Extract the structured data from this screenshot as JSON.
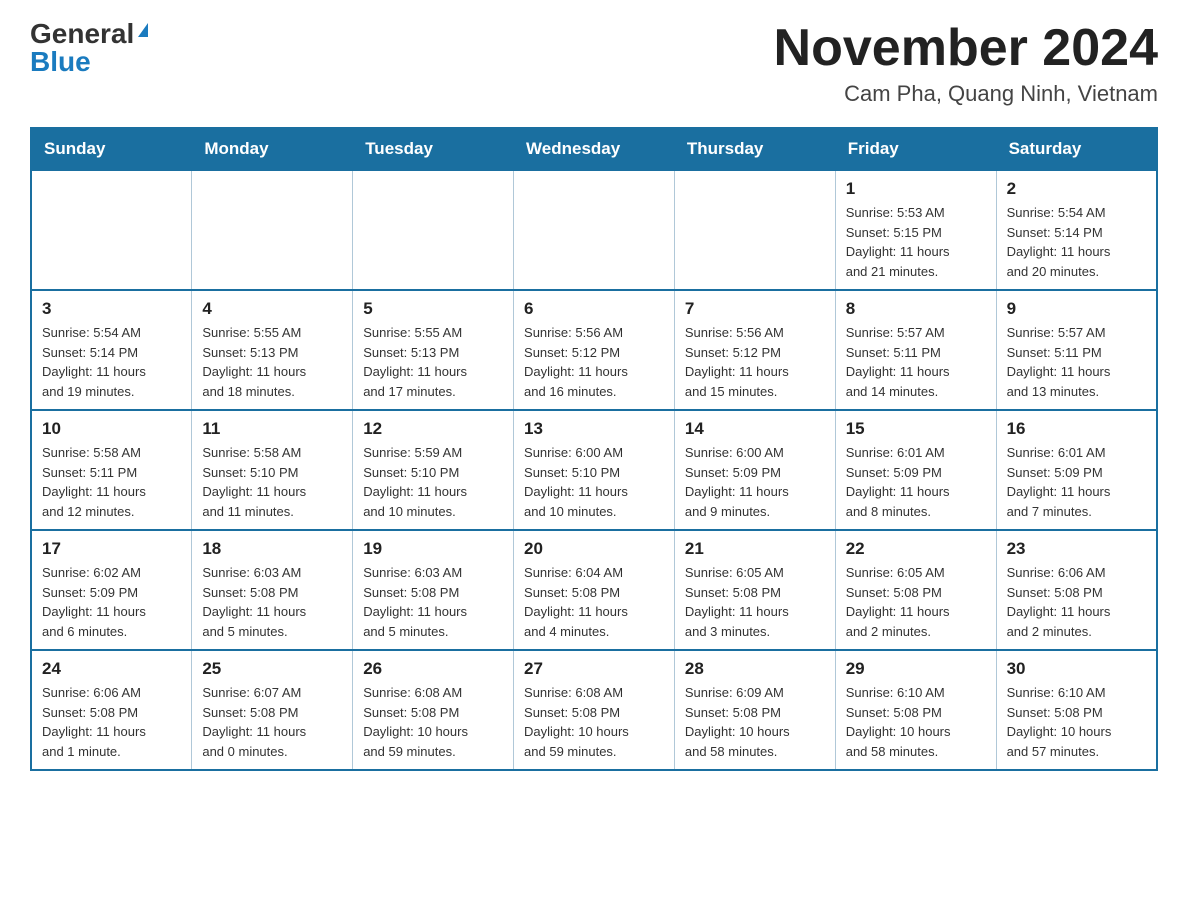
{
  "logo": {
    "general": "General",
    "blue": "Blue"
  },
  "title": "November 2024",
  "location": "Cam Pha, Quang Ninh, Vietnam",
  "days_of_week": [
    "Sunday",
    "Monday",
    "Tuesday",
    "Wednesday",
    "Thursday",
    "Friday",
    "Saturday"
  ],
  "weeks": [
    [
      {
        "day": "",
        "info": ""
      },
      {
        "day": "",
        "info": ""
      },
      {
        "day": "",
        "info": ""
      },
      {
        "day": "",
        "info": ""
      },
      {
        "day": "",
        "info": ""
      },
      {
        "day": "1",
        "info": "Sunrise: 5:53 AM\nSunset: 5:15 PM\nDaylight: 11 hours\nand 21 minutes."
      },
      {
        "day": "2",
        "info": "Sunrise: 5:54 AM\nSunset: 5:14 PM\nDaylight: 11 hours\nand 20 minutes."
      }
    ],
    [
      {
        "day": "3",
        "info": "Sunrise: 5:54 AM\nSunset: 5:14 PM\nDaylight: 11 hours\nand 19 minutes."
      },
      {
        "day": "4",
        "info": "Sunrise: 5:55 AM\nSunset: 5:13 PM\nDaylight: 11 hours\nand 18 minutes."
      },
      {
        "day": "5",
        "info": "Sunrise: 5:55 AM\nSunset: 5:13 PM\nDaylight: 11 hours\nand 17 minutes."
      },
      {
        "day": "6",
        "info": "Sunrise: 5:56 AM\nSunset: 5:12 PM\nDaylight: 11 hours\nand 16 minutes."
      },
      {
        "day": "7",
        "info": "Sunrise: 5:56 AM\nSunset: 5:12 PM\nDaylight: 11 hours\nand 15 minutes."
      },
      {
        "day": "8",
        "info": "Sunrise: 5:57 AM\nSunset: 5:11 PM\nDaylight: 11 hours\nand 14 minutes."
      },
      {
        "day": "9",
        "info": "Sunrise: 5:57 AM\nSunset: 5:11 PM\nDaylight: 11 hours\nand 13 minutes."
      }
    ],
    [
      {
        "day": "10",
        "info": "Sunrise: 5:58 AM\nSunset: 5:11 PM\nDaylight: 11 hours\nand 12 minutes."
      },
      {
        "day": "11",
        "info": "Sunrise: 5:58 AM\nSunset: 5:10 PM\nDaylight: 11 hours\nand 11 minutes."
      },
      {
        "day": "12",
        "info": "Sunrise: 5:59 AM\nSunset: 5:10 PM\nDaylight: 11 hours\nand 10 minutes."
      },
      {
        "day": "13",
        "info": "Sunrise: 6:00 AM\nSunset: 5:10 PM\nDaylight: 11 hours\nand 10 minutes."
      },
      {
        "day": "14",
        "info": "Sunrise: 6:00 AM\nSunset: 5:09 PM\nDaylight: 11 hours\nand 9 minutes."
      },
      {
        "day": "15",
        "info": "Sunrise: 6:01 AM\nSunset: 5:09 PM\nDaylight: 11 hours\nand 8 minutes."
      },
      {
        "day": "16",
        "info": "Sunrise: 6:01 AM\nSunset: 5:09 PM\nDaylight: 11 hours\nand 7 minutes."
      }
    ],
    [
      {
        "day": "17",
        "info": "Sunrise: 6:02 AM\nSunset: 5:09 PM\nDaylight: 11 hours\nand 6 minutes."
      },
      {
        "day": "18",
        "info": "Sunrise: 6:03 AM\nSunset: 5:08 PM\nDaylight: 11 hours\nand 5 minutes."
      },
      {
        "day": "19",
        "info": "Sunrise: 6:03 AM\nSunset: 5:08 PM\nDaylight: 11 hours\nand 5 minutes."
      },
      {
        "day": "20",
        "info": "Sunrise: 6:04 AM\nSunset: 5:08 PM\nDaylight: 11 hours\nand 4 minutes."
      },
      {
        "day": "21",
        "info": "Sunrise: 6:05 AM\nSunset: 5:08 PM\nDaylight: 11 hours\nand 3 minutes."
      },
      {
        "day": "22",
        "info": "Sunrise: 6:05 AM\nSunset: 5:08 PM\nDaylight: 11 hours\nand 2 minutes."
      },
      {
        "day": "23",
        "info": "Sunrise: 6:06 AM\nSunset: 5:08 PM\nDaylight: 11 hours\nand 2 minutes."
      }
    ],
    [
      {
        "day": "24",
        "info": "Sunrise: 6:06 AM\nSunset: 5:08 PM\nDaylight: 11 hours\nand 1 minute."
      },
      {
        "day": "25",
        "info": "Sunrise: 6:07 AM\nSunset: 5:08 PM\nDaylight: 11 hours\nand 0 minutes."
      },
      {
        "day": "26",
        "info": "Sunrise: 6:08 AM\nSunset: 5:08 PM\nDaylight: 10 hours\nand 59 minutes."
      },
      {
        "day": "27",
        "info": "Sunrise: 6:08 AM\nSunset: 5:08 PM\nDaylight: 10 hours\nand 59 minutes."
      },
      {
        "day": "28",
        "info": "Sunrise: 6:09 AM\nSunset: 5:08 PM\nDaylight: 10 hours\nand 58 minutes."
      },
      {
        "day": "29",
        "info": "Sunrise: 6:10 AM\nSunset: 5:08 PM\nDaylight: 10 hours\nand 58 minutes."
      },
      {
        "day": "30",
        "info": "Sunrise: 6:10 AM\nSunset: 5:08 PM\nDaylight: 10 hours\nand 57 minutes."
      }
    ]
  ]
}
